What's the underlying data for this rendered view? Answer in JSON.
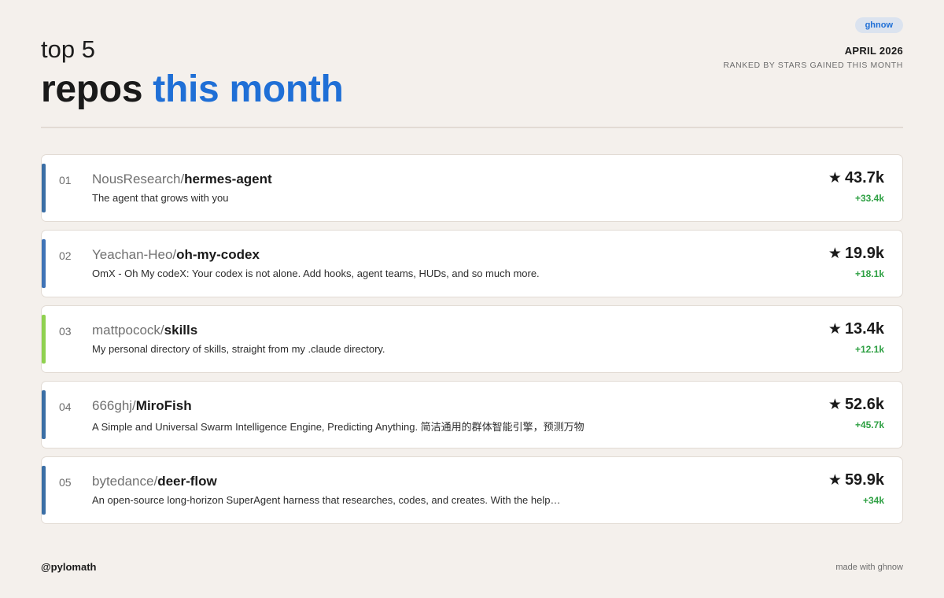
{
  "header": {
    "kicker": "top 5",
    "title_main": "repos",
    "title_accent": "this month",
    "badge": "ghnow",
    "period": "APRIL 2026",
    "subtitle": "RANKED BY STARS GAINED THIS MONTH"
  },
  "colors": {
    "accent": "#1f6fd6",
    "gain": "#2ea043",
    "bar_blue": "#3a6ea5",
    "bar_blue_light": "#3f73b6",
    "bar_green": "#8fd14f"
  },
  "repos": [
    {
      "rank": "01",
      "owner": "NousResearch/",
      "name": "hermes-agent",
      "description": "The agent that grows with you",
      "stars": "43.7k",
      "gain": "+33.4k",
      "star_icon": "★",
      "bar_color": "#3a6ea5"
    },
    {
      "rank": "02",
      "owner": "Yeachan-Heo/",
      "name": "oh-my-codex",
      "description": "OmX - Oh My codeX: Your codex is not alone. Add hooks, agent teams, HUDs, and so much more.",
      "stars": "19.9k",
      "gain": "+18.1k",
      "star_icon": "★",
      "bar_color": "#3f73b6"
    },
    {
      "rank": "03",
      "owner": "mattpocock/",
      "name": "skills",
      "description": "My personal directory of skills, straight from my .claude directory.",
      "stars": "13.4k",
      "gain": "+12.1k",
      "star_icon": "★",
      "bar_color": "#8fd14f"
    },
    {
      "rank": "04",
      "owner": "666ghj/",
      "name": "MiroFish",
      "description": "A Simple and Universal Swarm Intelligence Engine, Predicting Anything. 简洁通用的群体智能引擎，预测万物",
      "stars": "52.6k",
      "gain": "+45.7k",
      "star_icon": "★",
      "bar_color": "#3a6ea5"
    },
    {
      "rank": "05",
      "owner": "bytedance/",
      "name": "deer-flow",
      "description": "An open-source long-horizon SuperAgent harness that researches, codes, and creates. With the help…",
      "stars": "59.9k",
      "gain": "+34k",
      "star_icon": "★",
      "bar_color": "#3a6ea5"
    }
  ],
  "footer": {
    "handle": "@pylomath",
    "credit": "made with ghnow"
  }
}
